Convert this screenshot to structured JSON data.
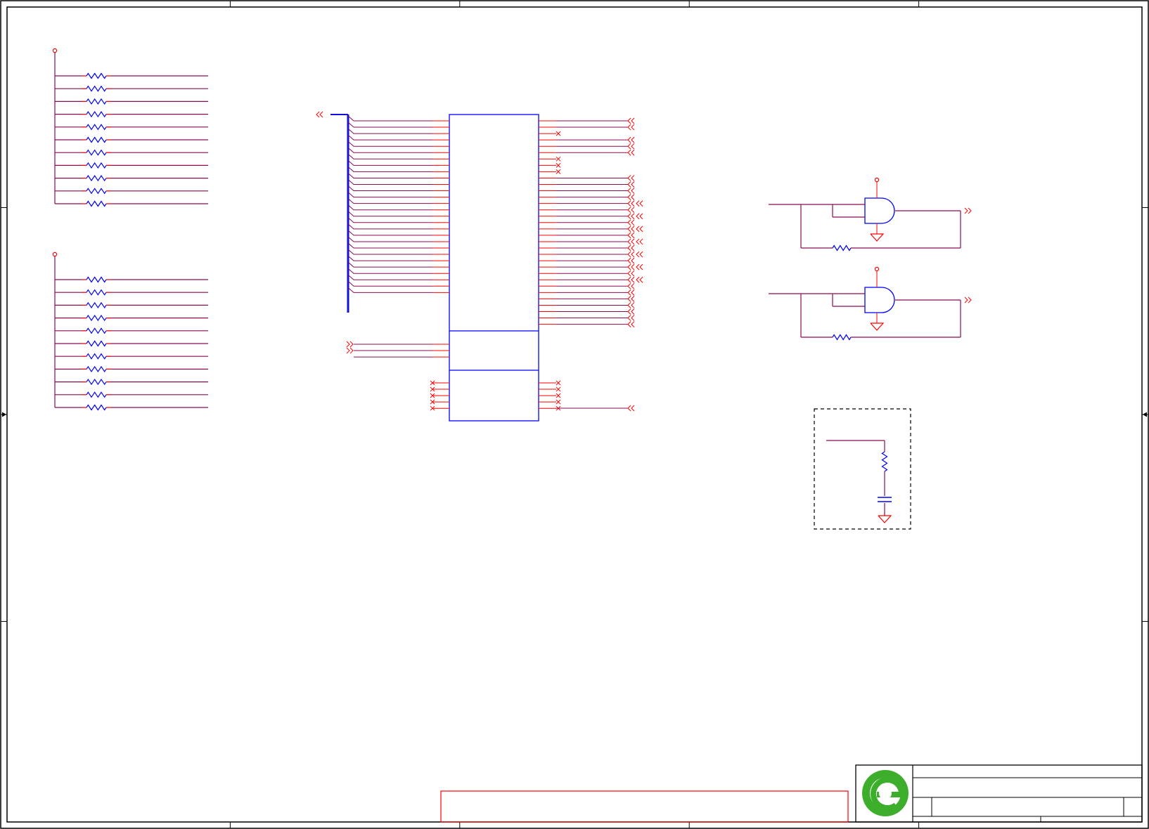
{
  "sheet": {
    "zone_columns": 5,
    "zone_rows": 4
  },
  "colors": {
    "border": "#000000",
    "wire": "#8b0a50",
    "pin": "#ff0000",
    "part": "#0000ff",
    "bus": "#1010e0",
    "marker": "#ff0000",
    "logo": "#3dae2b"
  },
  "resistor_arrays": [
    {
      "rows": 11
    },
    {
      "rows": 11
    }
  ],
  "main_ic": {
    "left_bus_pins": 28,
    "left_input_pins": 3,
    "left_nc_pins": 5,
    "right_net_pins": 33,
    "right_nc_pins": 5,
    "right_bottom_pin": 1,
    "sections": 3
  },
  "and_gates": [
    {
      "label": ""
    },
    {
      "label": ""
    }
  ],
  "optional_block": {
    "style": "dashed"
  },
  "title_block": {
    "logo": "company-logo-green-e",
    "title": "",
    "size": "",
    "document_number": "",
    "revision": "",
    "date": "",
    "sheet": ""
  },
  "notes_box": {
    "text": ""
  }
}
